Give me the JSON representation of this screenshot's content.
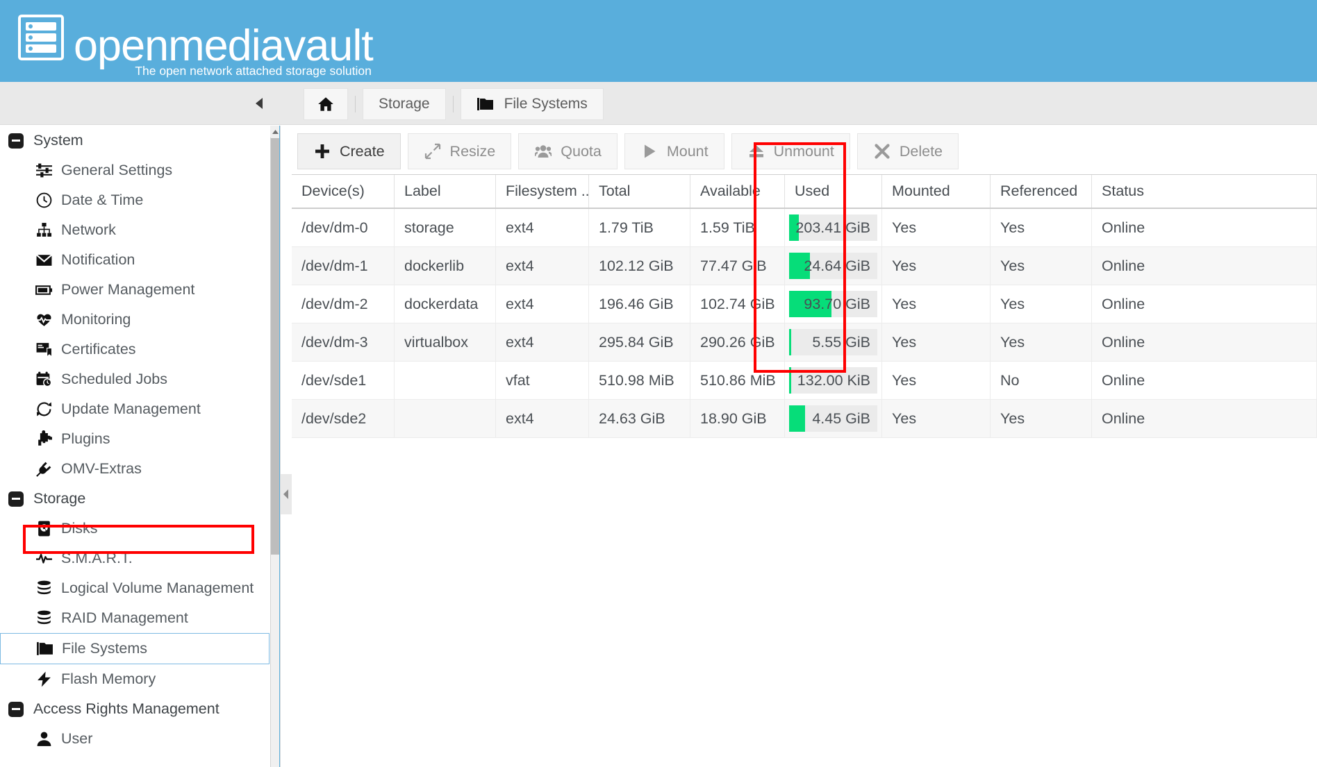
{
  "banner": {
    "logo_word": "openmediavault",
    "tagline": "The open network attached storage solution",
    "brand_color": "#59aedc"
  },
  "breadcrumb": {
    "collapse_icon": "chevron-left-icon",
    "items": [
      {
        "label": "",
        "icon": "home-icon"
      },
      {
        "label": "Storage",
        "icon": ""
      },
      {
        "label": "File Systems",
        "icon": "folder-icon"
      }
    ]
  },
  "sidebar": {
    "items": [
      {
        "label": "System",
        "type": "group",
        "icon": "collapse-minus-icon"
      },
      {
        "label": "General Settings",
        "type": "item",
        "icon": "sliders-icon"
      },
      {
        "label": "Date & Time",
        "type": "item",
        "icon": "clock-icon"
      },
      {
        "label": "Network",
        "type": "item",
        "icon": "sitemap-icon"
      },
      {
        "label": "Notification",
        "type": "item",
        "icon": "envelope-icon"
      },
      {
        "label": "Power Management",
        "type": "item",
        "icon": "battery-icon"
      },
      {
        "label": "Monitoring",
        "type": "item",
        "icon": "heartbeat-icon"
      },
      {
        "label": "Certificates",
        "type": "item",
        "icon": "certificate-icon"
      },
      {
        "label": "Scheduled Jobs",
        "type": "item",
        "icon": "calendar-clock-icon"
      },
      {
        "label": "Update Management",
        "type": "item",
        "icon": "refresh-icon"
      },
      {
        "label": "Plugins",
        "type": "item",
        "icon": "puzzle-icon"
      },
      {
        "label": "OMV-Extras",
        "type": "item",
        "icon": "plug-icon"
      },
      {
        "label": "Storage",
        "type": "group",
        "icon": "collapse-minus-icon"
      },
      {
        "label": "Disks",
        "type": "item",
        "icon": "hdd-icon"
      },
      {
        "label": "S.M.A.R.T.",
        "type": "item",
        "icon": "pulse-icon"
      },
      {
        "label": "Logical Volume Management",
        "type": "item",
        "icon": "database-icon"
      },
      {
        "label": "RAID Management",
        "type": "item",
        "icon": "database-icon"
      },
      {
        "label": "File Systems",
        "type": "item",
        "icon": "folder-icon",
        "selected": true,
        "highlighted": true
      },
      {
        "label": "Flash Memory",
        "type": "item",
        "icon": "bolt-icon"
      },
      {
        "label": "Access Rights Management",
        "type": "group",
        "icon": "collapse-minus-icon"
      },
      {
        "label": "User",
        "type": "item",
        "icon": "user-icon"
      }
    ],
    "highlight_color": "#ff0000",
    "selection_border_color": "#7cb9e2"
  },
  "toolbar": {
    "buttons": [
      {
        "label": "Create",
        "icon": "plus-icon",
        "enabled": true
      },
      {
        "label": "Resize",
        "icon": "expand-icon",
        "enabled": false
      },
      {
        "label": "Quota",
        "icon": "users-icon",
        "enabled": false
      },
      {
        "label": "Mount",
        "icon": "play-icon",
        "enabled": false
      },
      {
        "label": "Unmount",
        "icon": "eject-icon",
        "enabled": false
      },
      {
        "label": "Delete",
        "icon": "times-icon",
        "enabled": false
      }
    ]
  },
  "grid": {
    "columns": [
      "Device(s)",
      "Label",
      "Filesystem ...",
      "Total",
      "Available",
      "Used",
      "Mounted",
      "Referenced",
      "Status"
    ],
    "highlighted_column": "Mounted",
    "used_bar_color": "#06dd79",
    "rows": [
      {
        "device": "/dev/dm-0",
        "label": "storage",
        "filesystem": "ext4",
        "total": "1.79 TiB",
        "available": "1.59 TiB",
        "used": "203.41 GiB",
        "used_percent": 11,
        "mounted": "Yes",
        "referenced": "Yes",
        "status": "Online"
      },
      {
        "device": "/dev/dm-1",
        "label": "dockerlib",
        "filesystem": "ext4",
        "total": "102.12 GiB",
        "available": "77.47 GiB",
        "used": "24.64 GiB",
        "used_percent": 24,
        "mounted": "Yes",
        "referenced": "Yes",
        "status": "Online"
      },
      {
        "device": "/dev/dm-2",
        "label": "dockerdata",
        "filesystem": "ext4",
        "total": "196.46 GiB",
        "available": "102.74 GiB",
        "used": "93.70 GiB",
        "used_percent": 48,
        "mounted": "Yes",
        "referenced": "Yes",
        "status": "Online"
      },
      {
        "device": "/dev/dm-3",
        "label": "virtualbox",
        "filesystem": "ext4",
        "total": "295.84 GiB",
        "available": "290.26 GiB",
        "used": "5.55 GiB",
        "used_percent": 2,
        "mounted": "Yes",
        "referenced": "Yes",
        "status": "Online"
      },
      {
        "device": "/dev/sde1",
        "label": "",
        "filesystem": "vfat",
        "total": "510.98 MiB",
        "available": "510.86 MiB",
        "used": "132.00 KiB",
        "used_percent": 2,
        "mounted": "Yes",
        "referenced": "No",
        "status": "Online"
      },
      {
        "device": "/dev/sde2",
        "label": "",
        "filesystem": "ext4",
        "total": "24.63 GiB",
        "available": "18.90 GiB",
        "used": "4.45 GiB",
        "used_percent": 18,
        "mounted": "Yes",
        "referenced": "Yes",
        "status": "Online"
      }
    ]
  }
}
